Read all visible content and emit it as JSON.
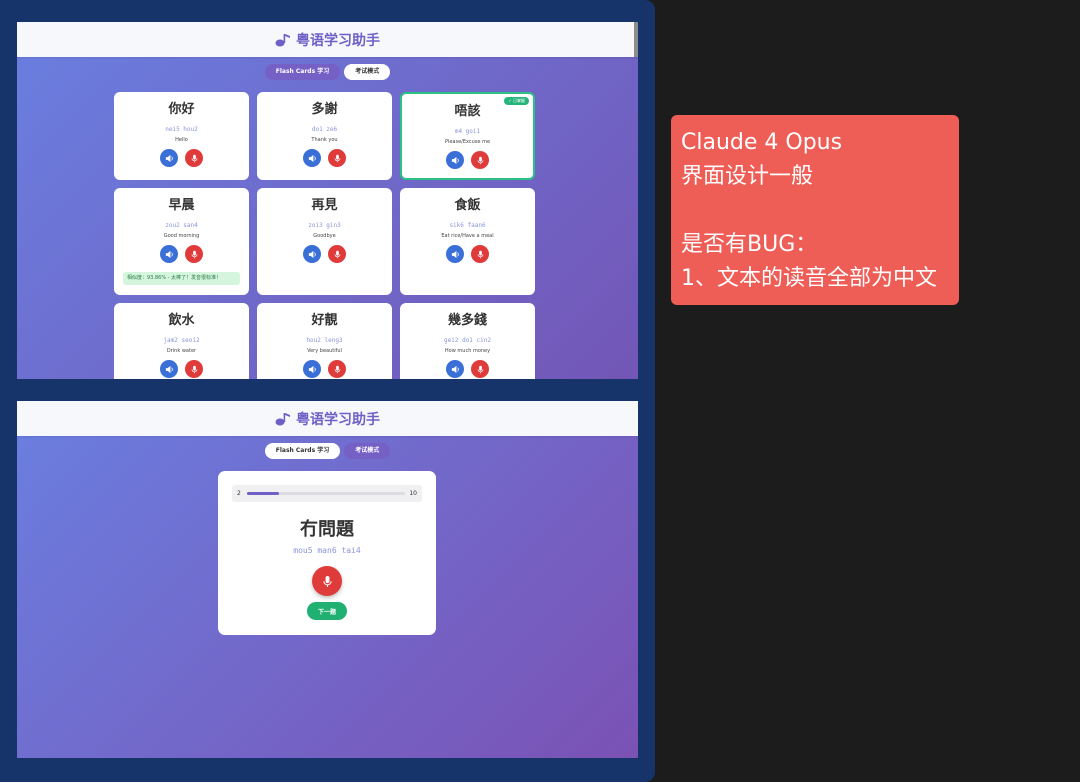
{
  "app": {
    "title": "粤语学习助手",
    "icon": "music-note-icon",
    "accent_color": "#6f5fc7"
  },
  "top_screen": {
    "tabs": [
      {
        "label": "Flash Cards 学习",
        "active": true
      },
      {
        "label": "考试模式",
        "active": false
      }
    ],
    "cards": [
      {
        "hanzi": "你好",
        "jyutping": "nei5 hou2",
        "meaning": "Hello"
      },
      {
        "hanzi": "多謝",
        "jyutping": "do1 ze6",
        "meaning": "Thank you"
      },
      {
        "hanzi": "唔該",
        "jyutping": "m4 goi1",
        "meaning": "Please/Excuse me",
        "badge": "✓ 已掌握"
      },
      {
        "hanzi": "早晨",
        "jyutping": "zou2 san4",
        "meaning": "Good morning",
        "score_text": "相似度：93.86% - 太棒了！发音很标准！"
      },
      {
        "hanzi": "再見",
        "jyutping": "zoi3 gin3",
        "meaning": "Goodbye"
      },
      {
        "hanzi": "食飯",
        "jyutping": "sik6 faan6",
        "meaning": "Eat rice/Have a meal"
      },
      {
        "hanzi": "飲水",
        "jyutping": "jam2 seoi2",
        "meaning": "Drink water"
      },
      {
        "hanzi": "好靚",
        "jyutping": "hou2 leng3",
        "meaning": "Very beautiful"
      },
      {
        "hanzi": "幾多錢",
        "jyutping": "gei2 do1 cin2",
        "meaning": "How much money"
      }
    ]
  },
  "bottom_screen": {
    "tabs": [
      {
        "label": "Flash Cards 学习",
        "active": false
      },
      {
        "label": "考试模式",
        "active": true
      }
    ],
    "quiz": {
      "current": "2",
      "total": "10",
      "progress": 0.2,
      "word": "冇問題",
      "jyutping": "mou5 man6 tai4",
      "next_label": "下一题"
    }
  },
  "note": {
    "line1": "Claude 4 Opus",
    "line2": "界面设计一般",
    "line3": "是否有BUG：",
    "line4": "1、文本的读音全部为中文"
  }
}
